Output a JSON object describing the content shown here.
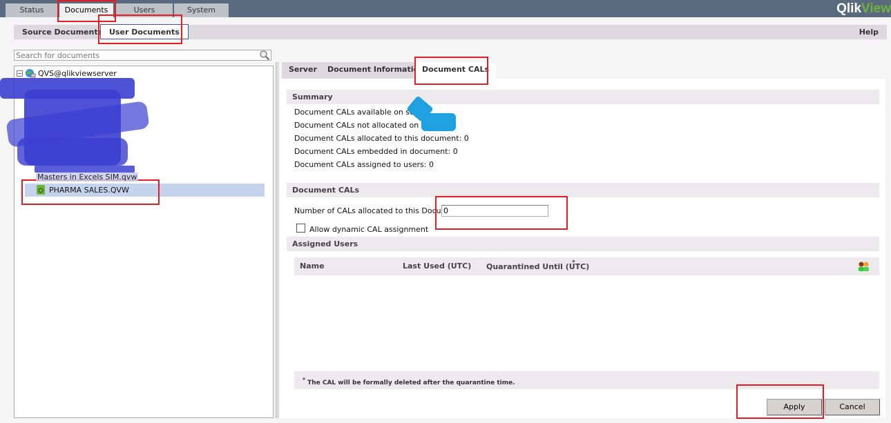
{
  "top_tabs": [
    {
      "label": "Status"
    },
    {
      "label": "Documents",
      "active": true
    },
    {
      "label": "Users"
    },
    {
      "label": "System"
    }
  ],
  "logo": {
    "part1": "Qlik",
    "part2": "View"
  },
  "sub_tabs": [
    {
      "label": "Source Documents"
    },
    {
      "label": "User Documents",
      "active": true
    }
  ],
  "help_label": "Help",
  "search": {
    "placeholder": "Search for documents",
    "value": ""
  },
  "tree": {
    "root": "QVS@qlikviewserver",
    "items": [
      {
        "label": "Masters in Excels SIM.qvw",
        "redacted": true
      },
      {
        "label": "PHARMA SALES.QVW",
        "selected": true
      }
    ]
  },
  "detail_tabs": [
    {
      "label": "Server"
    },
    {
      "label": "Document Information"
    },
    {
      "label": "Document CALs",
      "active": true
    }
  ],
  "summary": {
    "title": "Summary",
    "lines": [
      "Document CALs available on server:",
      "Document CALs not allocated on server:",
      "Document CALs allocated to this document: 0",
      "Document CALs embedded in document: 0",
      "Document CALs assigned to users: 0"
    ]
  },
  "document_cals": {
    "title": "Document CALs",
    "number_label": "Number of CALs allocated to this Document:",
    "number_value": "0",
    "dynamic_label": "Allow dynamic CAL assignment",
    "dynamic_checked": false
  },
  "assigned_users": {
    "title": "Assigned Users",
    "columns": [
      "Name",
      "Last Used (UTC)",
      "Quarantined Until (UTC)"
    ],
    "asterisk": "*",
    "rows": []
  },
  "footnote": {
    "asterisk": "*",
    "text": "The CAL will be formally deleted after the quarantine time."
  },
  "buttons": {
    "apply": "Apply",
    "cancel": "Cancel"
  },
  "colors": {
    "topbar": "#5a6a7e",
    "brand_green": "#6fb33b",
    "annotation_red": "#e51c23",
    "selection": "#c5d3ec"
  }
}
